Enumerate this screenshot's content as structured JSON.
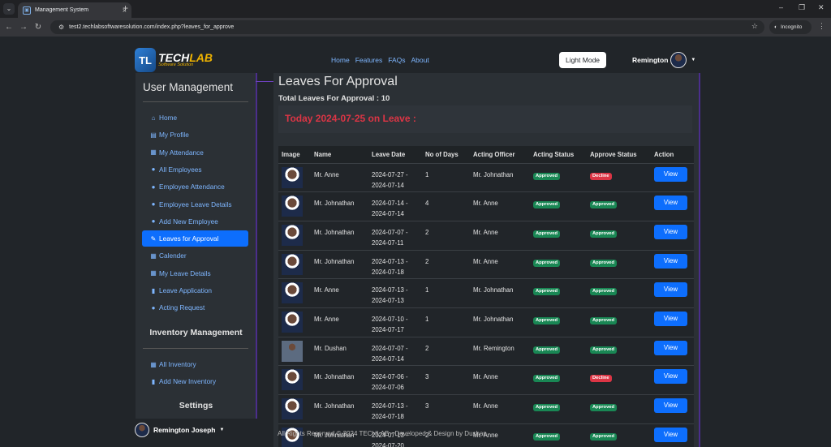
{
  "browser": {
    "tab_title": "Management System",
    "url": "test2.techlabsoftwaresolution.com/index.php?leaves_for_approve",
    "incognito_label": "Incognito"
  },
  "logo": {
    "mark": "TL",
    "text_a": "TECH",
    "text_b": "LAB",
    "tagline": "Software Solution"
  },
  "topnav": {
    "home": "Home",
    "features": "Features",
    "faqs": "FAQs",
    "about": "About"
  },
  "light_mode_label": "Light Mode",
  "user": {
    "name": "Remington",
    "full_name": "Remington Joseph"
  },
  "sidebar": {
    "title": "User Management",
    "items": [
      {
        "label": "Home",
        "icon": "home-icon",
        "glyph": "⌂"
      },
      {
        "label": "My Profile",
        "icon": "id-card-icon",
        "glyph": "▤"
      },
      {
        "label": "My Attendance",
        "icon": "calendar-icon",
        "glyph": "▦"
      },
      {
        "label": "All Employees",
        "icon": "user-icon",
        "glyph": "●"
      },
      {
        "label": "Employee Attendance",
        "icon": "user-check-icon",
        "glyph": "●"
      },
      {
        "label": "Employee Leave Details",
        "icon": "user-list-icon",
        "glyph": "●"
      },
      {
        "label": "Add New Employee",
        "icon": "user-plus-icon",
        "glyph": "●"
      },
      {
        "label": "Leaves for Approval",
        "icon": "signature-icon",
        "glyph": "✎"
      },
      {
        "label": "Calender",
        "icon": "calendar-day-icon",
        "glyph": "▦"
      },
      {
        "label": "My Leave Details",
        "icon": "table-icon",
        "glyph": "▦"
      },
      {
        "label": "Leave Application",
        "icon": "file-icon",
        "glyph": "▮"
      },
      {
        "label": "Acting Request",
        "icon": "user-clock-icon",
        "glyph": "●"
      }
    ],
    "inventory_title": "Inventory Management",
    "inventory_items": [
      {
        "label": "All Inventory",
        "icon": "warehouse-icon",
        "glyph": "▦"
      },
      {
        "label": "Add New Inventory",
        "icon": "file-plus-icon",
        "glyph": "▮"
      }
    ],
    "settings_title": "Settings"
  },
  "main": {
    "title": "Leaves For Approval",
    "total": "Total Leaves For Approval : 10",
    "today": "Today 2024-07-25 on Leave :",
    "columns": [
      "Image",
      "Name",
      "Leave Date",
      "No of Days",
      "Acting Officer",
      "Acting Status",
      "Approve Status",
      "Action"
    ],
    "rows": [
      {
        "name": "Mr. Anne",
        "date1": "2024-07-27 -",
        "date2": "2024-07-14",
        "days": "1",
        "officer": "Mr. Johnathan",
        "acting": "Approved",
        "approve": "Decline",
        "action": "View"
      },
      {
        "name": "Mr. Johnathan",
        "date1": "2024-07-14 -",
        "date2": "2024-07-14",
        "days": "4",
        "officer": "Mr. Anne",
        "acting": "Approved",
        "approve": "Approved",
        "action": "View"
      },
      {
        "name": "Mr. Johnathan",
        "date1": "2024-07-07 -",
        "date2": "2024-07-11",
        "days": "2",
        "officer": "Mr. Anne",
        "acting": "Approved",
        "approve": "Approved",
        "action": "View"
      },
      {
        "name": "Mr. Johnathan",
        "date1": "2024-07-13 -",
        "date2": "2024-07-18",
        "days": "2",
        "officer": "Mr. Anne",
        "acting": "Approved",
        "approve": "Approved",
        "action": "View"
      },
      {
        "name": "Mr. Anne",
        "date1": "2024-07-13 -",
        "date2": "2024-07-13",
        "days": "1",
        "officer": "Mr. Johnathan",
        "acting": "Approved",
        "approve": "Approved",
        "action": "View"
      },
      {
        "name": "Mr. Anne",
        "date1": "2024-07-10 -",
        "date2": "2024-07-17",
        "days": "1",
        "officer": "Mr. Johnathan",
        "acting": "Approved",
        "approve": "Approved",
        "action": "View"
      },
      {
        "name": "Mr. Dushan",
        "date1": "2024-07-07 -",
        "date2": "2024-07-14",
        "days": "2",
        "officer": "Mr. Remington",
        "acting": "Approved",
        "approve": "Approved",
        "action": "View"
      },
      {
        "name": "Mr. Johnathan",
        "date1": "2024-07-06 -",
        "date2": "2024-07-06",
        "days": "3",
        "officer": "Mr. Anne",
        "acting": "Approved",
        "approve": "Decline",
        "action": "View"
      },
      {
        "name": "Mr. Johnathan",
        "date1": "2024-07-13 -",
        "date2": "2024-07-18",
        "days": "3",
        "officer": "Mr. Anne",
        "acting": "Approved",
        "approve": "Approved",
        "action": "View"
      },
      {
        "name": "Mr. Johnathan",
        "date1": "2024-07-13 -",
        "date2": "2024-07-20",
        "days": "2",
        "officer": "Mr. Anne",
        "acting": "Approved",
        "approve": "Approved",
        "action": "View"
      }
    ]
  },
  "footer": "All Rights Reserved © 2024 TECHLAB - Developed & Design by Dushan",
  "colors": {
    "primary": "#0d6efd",
    "success": "#198754",
    "danger": "#dc3545",
    "accent": "#6f42c1"
  }
}
